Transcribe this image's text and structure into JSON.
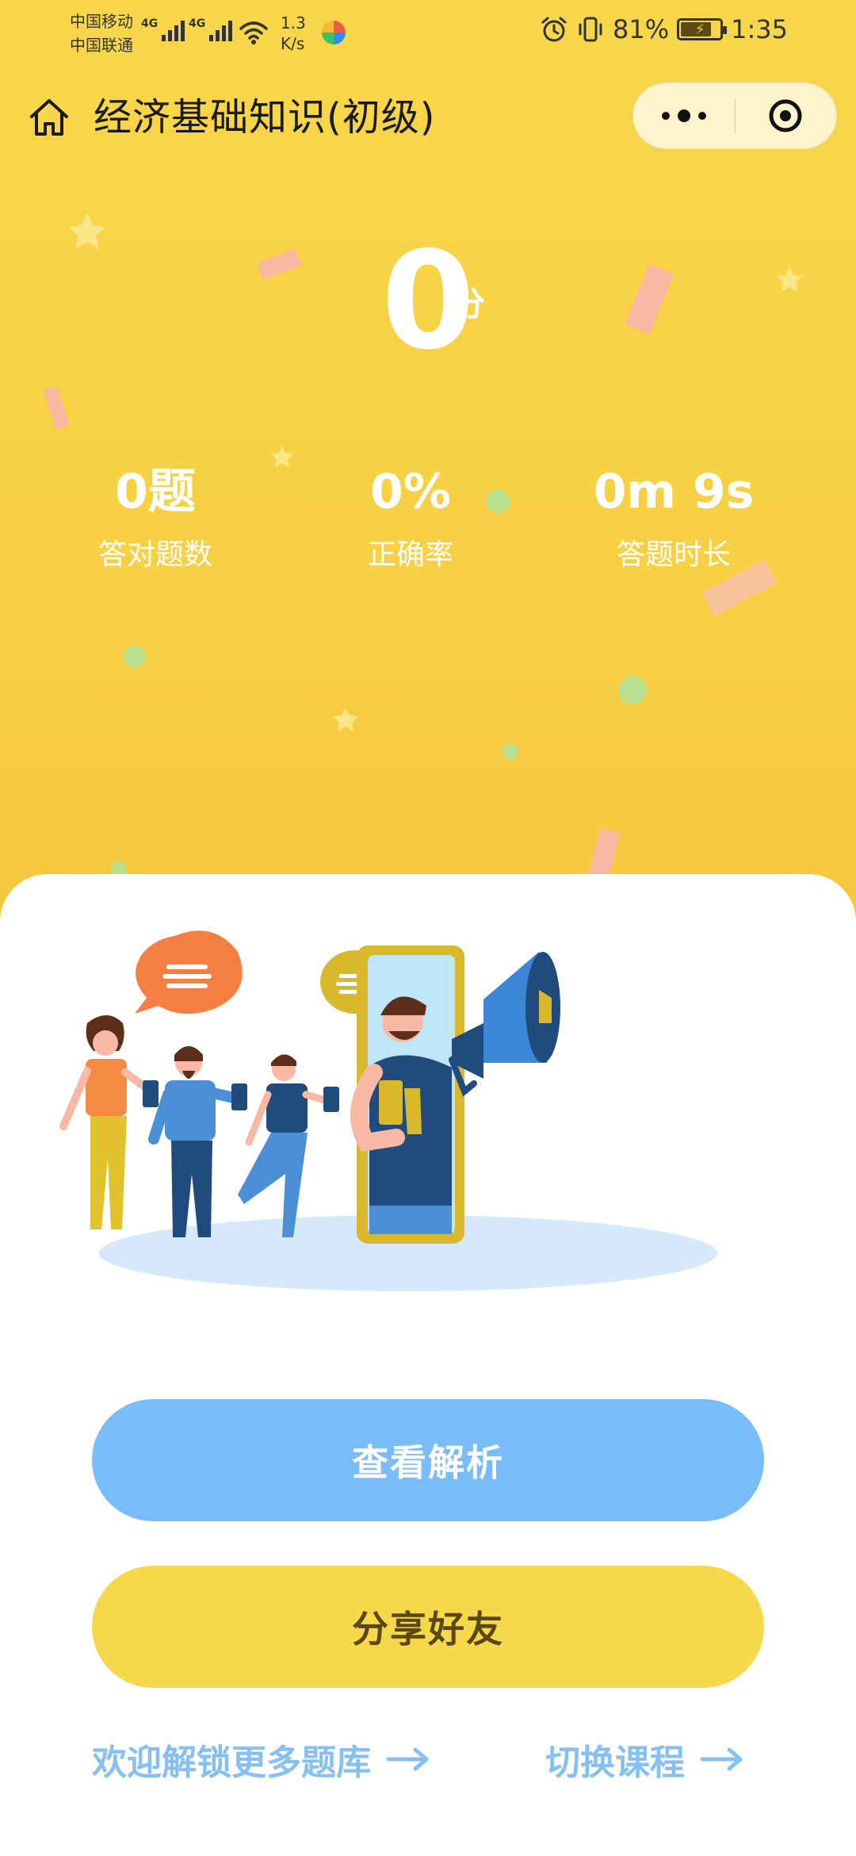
{
  "status_bar": {
    "carrier_1": "中国移动",
    "carrier_2": "中国联通",
    "net_tag_1": "4G",
    "net_tag_2": "4G",
    "speed_value": "1.3",
    "speed_unit": "K/s",
    "battery_percent": "81%",
    "battery_level": 0.81,
    "time": "1:35"
  },
  "nav": {
    "title": "经济基础知识(初级)"
  },
  "score": {
    "value": "0",
    "unit": "分"
  },
  "stats": [
    {
      "value": "0题",
      "label": "答对题数"
    },
    {
      "value": "0%",
      "label": "正确率"
    },
    {
      "value": "0m 9s",
      "label": "答题时长"
    }
  ],
  "buttons": {
    "analysis": "查看解析",
    "share": "分享好友"
  },
  "links": {
    "unlock": "欢迎解锁更多题库",
    "switch": "切换课程"
  },
  "colors": {
    "header_bg": "#f7d043",
    "analysis_btn": "#78bdfa",
    "share_btn": "#f7d84a",
    "link_text": "#86c0f3"
  },
  "icons": {
    "home": "home-icon",
    "more": "more-dots-icon",
    "close": "target-close-icon",
    "arrow": "right-arrow-icon"
  }
}
